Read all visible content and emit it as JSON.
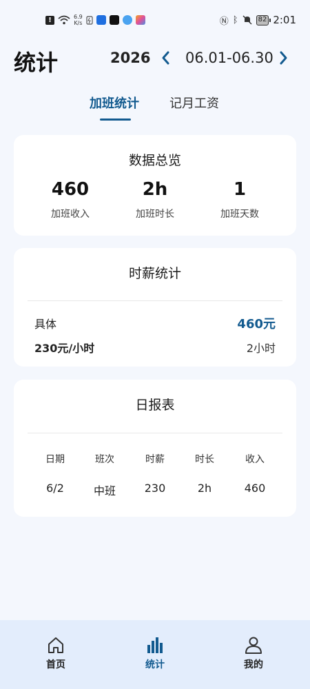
{
  "status_bar": {
    "speed_value": "6.9",
    "speed_unit": "K/s",
    "battery": "82",
    "time": "2:01"
  },
  "header": {
    "title": "统计",
    "year": "2026",
    "date_range": "06.01-06.30"
  },
  "tabs": [
    {
      "label": "加班统计",
      "active": true
    },
    {
      "label": "记月工资",
      "active": false
    }
  ],
  "overview": {
    "title": "数据总览",
    "stats": [
      {
        "value": "460",
        "label": "加班收入"
      },
      {
        "value": "2h",
        "label": "加班时长"
      },
      {
        "value": "1",
        "label": "加班天数"
      }
    ]
  },
  "hourly": {
    "title": "时薪统计",
    "detail_label": "具体",
    "detail_value": "460元",
    "rate_label": "230元/小时",
    "hours_value": "2小时"
  },
  "daily": {
    "title": "日报表",
    "columns": [
      "日期",
      "班次",
      "时薪",
      "时长",
      "收入"
    ],
    "rows": [
      [
        "6/2",
        "中班",
        "230",
        "2h",
        "460"
      ]
    ]
  },
  "bottom_nav": [
    {
      "label": "首页",
      "icon": "home-icon",
      "active": false
    },
    {
      "label": "统计",
      "icon": "bar-chart-icon",
      "active": true
    },
    {
      "label": "我的",
      "icon": "person-icon",
      "active": false
    }
  ],
  "colors": {
    "accent": "#125a8f",
    "background": "#f4f7fd",
    "nav_background": "#e3edfc"
  }
}
